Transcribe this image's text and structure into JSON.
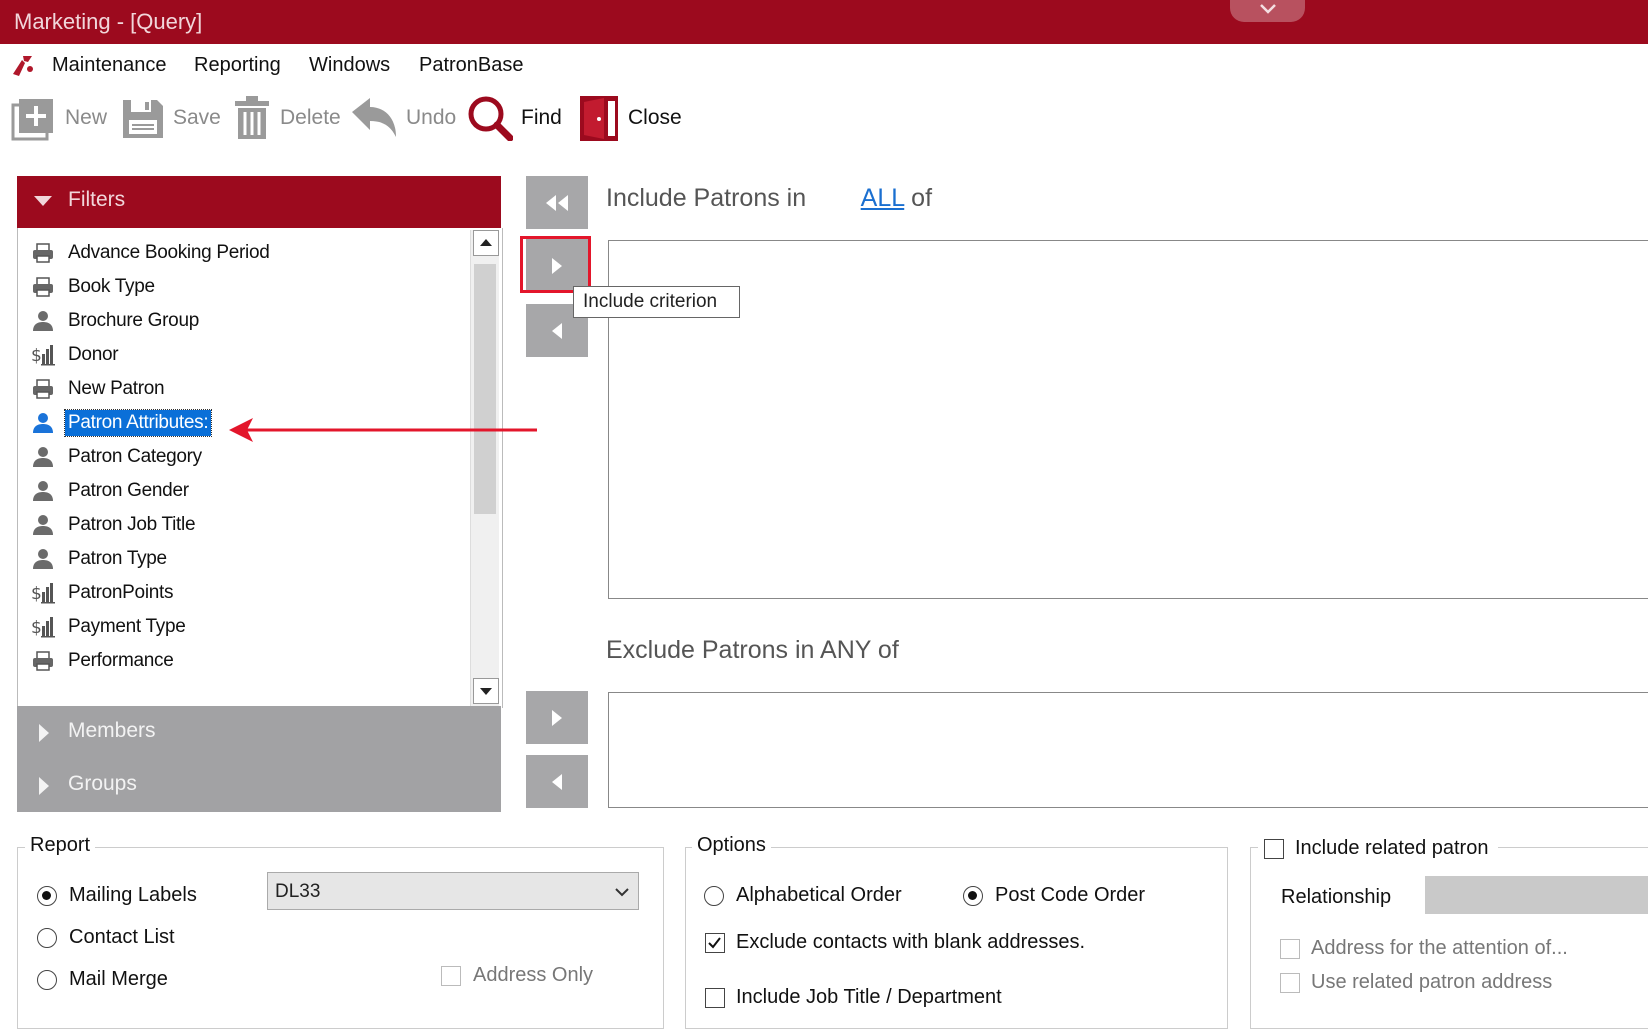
{
  "window": {
    "title": "Marketing - [Query]"
  },
  "menu": {
    "items": [
      "Maintenance",
      "Reporting",
      "Windows",
      "PatronBase"
    ]
  },
  "toolbar": {
    "new_label": "New",
    "save_label": "Save",
    "delete_label": "Delete",
    "undo_label": "Undo",
    "find_label": "Find",
    "close_label": "Close"
  },
  "filters": {
    "header": "Filters",
    "items": [
      {
        "label": "Advance Booking Period",
        "icon": "printer-icon"
      },
      {
        "label": "Book Type",
        "icon": "printer-icon"
      },
      {
        "label": "Brochure Group",
        "icon": "person-icon"
      },
      {
        "label": "Donor",
        "icon": "dollar-chart-icon"
      },
      {
        "label": "New Patron",
        "icon": "printer-icon"
      },
      {
        "label": "Patron Attributes:",
        "icon": "person-blue-icon",
        "selected": true
      },
      {
        "label": "Patron Category",
        "icon": "person-icon"
      },
      {
        "label": "Patron Gender",
        "icon": "person-icon"
      },
      {
        "label": "Patron Job Title",
        "icon": "person-icon"
      },
      {
        "label": "Patron Type",
        "icon": "person-icon"
      },
      {
        "label": "PatronPoints",
        "icon": "dollar-chart-icon"
      },
      {
        "label": "Payment Type",
        "icon": "dollar-chart-icon"
      },
      {
        "label": "Performance",
        "icon": "printer-icon"
      }
    ]
  },
  "sections": {
    "members": "Members",
    "groups": "Groups"
  },
  "criteria": {
    "include_prefix": "Include Patrons in",
    "include_link": "ALL",
    "include_suffix": "of",
    "exclude_title": "Exclude Patrons in ANY of",
    "tooltip": "Include criterion"
  },
  "report": {
    "legend": "Report",
    "options": [
      "Mailing Labels",
      "Contact List",
      "Mail Merge"
    ],
    "selected": "Mailing Labels",
    "label_format": "DL33",
    "address_only": "Address Only"
  },
  "options": {
    "legend": "Options",
    "alphabetical": "Alphabetical Order",
    "postcode": "Post Code Order",
    "selected_order": "Post Code Order",
    "exclude_blank": "Exclude contacts with blank addresses.",
    "exclude_blank_checked": true,
    "include_job_title": "Include Job Title / Department",
    "include_job_title_checked": false
  },
  "related": {
    "legend": "Include related patron",
    "relationship_label": "Relationship",
    "attention": "Address for the attention of...",
    "use_related": "Use related patron address"
  },
  "colors": {
    "brand": "#9c0a1e",
    "selection": "#0a6fd8",
    "highlight": "#e3162b"
  }
}
